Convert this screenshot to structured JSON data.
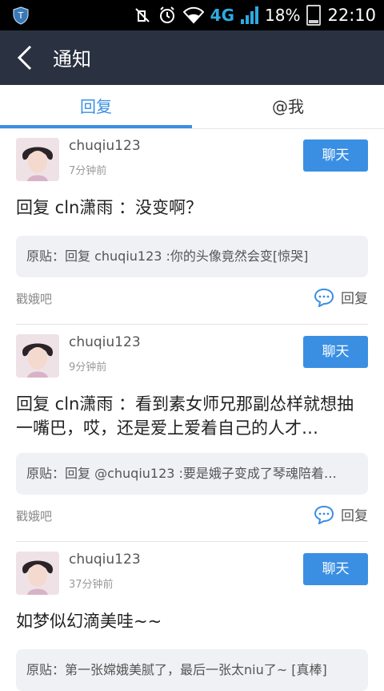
{
  "status": {
    "net": "4G",
    "battery": "18%",
    "time": "22:10"
  },
  "header": {
    "title": "通知"
  },
  "tabs": [
    {
      "label": "回复"
    },
    {
      "label": "@我"
    }
  ],
  "posts": [
    {
      "user": "chuqiu123",
      "time": "7分钟前",
      "chat_label": "聊天",
      "body": "回复 cln潇雨 ：没变啊？",
      "quote": "原贴：回复 chuqiu123 :你的头像竟然会变[惊哭]",
      "forum": "戳娥吧",
      "reply_label": "回复"
    },
    {
      "user": "chuqiu123",
      "time": "9分钟前",
      "chat_label": "聊天",
      "body": "回复 cln潇雨 ：看到素女师兄那副怂样就想抽一嘴巴，哎，还是爱上爱着自己的人才…",
      "quote": "原贴：回复 @chuqiu123 :要是娥子变成了琴魂陪着…",
      "forum": "戳娥吧",
      "reply_label": "回复"
    },
    {
      "user": "chuqiu123",
      "time": "37分钟前",
      "chat_label": "聊天",
      "body": "如梦似幻滴美哇~~",
      "quote": "原贴：第一张嫦娥美腻了，最后一张太niu了~ [真棒]",
      "forum": "",
      "reply_label": ""
    }
  ]
}
